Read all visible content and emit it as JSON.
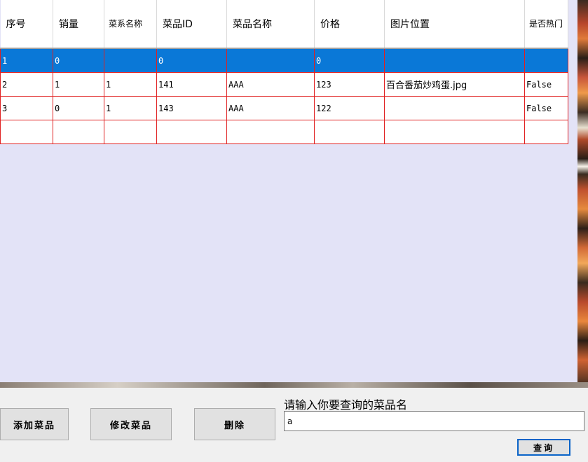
{
  "grid": {
    "columns": [
      "序号",
      "销量",
      "菜系名称",
      "菜品ID",
      "菜品名称",
      "价格",
      "图片位置",
      "是否热门"
    ],
    "rows": [
      [
        "1",
        "0",
        "",
        "0",
        "",
        "0",
        "",
        ""
      ],
      [
        "2",
        "1",
        "1",
        "141",
        "AAA",
        "123",
        "百合番茄炒鸡蛋.jpg",
        "False"
      ],
      [
        "3",
        "0",
        "1",
        "143",
        "AAA",
        "122",
        "",
        "False"
      ],
      [
        "",
        "",
        "",
        "",
        "",
        "",
        "",
        ""
      ]
    ],
    "selected_row": 0
  },
  "buttons": {
    "add": "添加菜品",
    "edit": "修改菜品",
    "delete": "删除"
  },
  "query": {
    "label": "请输入你要查询的菜品名",
    "value": "a",
    "button": "查询"
  },
  "colors": {
    "selection": "#0a78d7",
    "grid_border": "#e02020",
    "panel": "#e3e3f7"
  }
}
